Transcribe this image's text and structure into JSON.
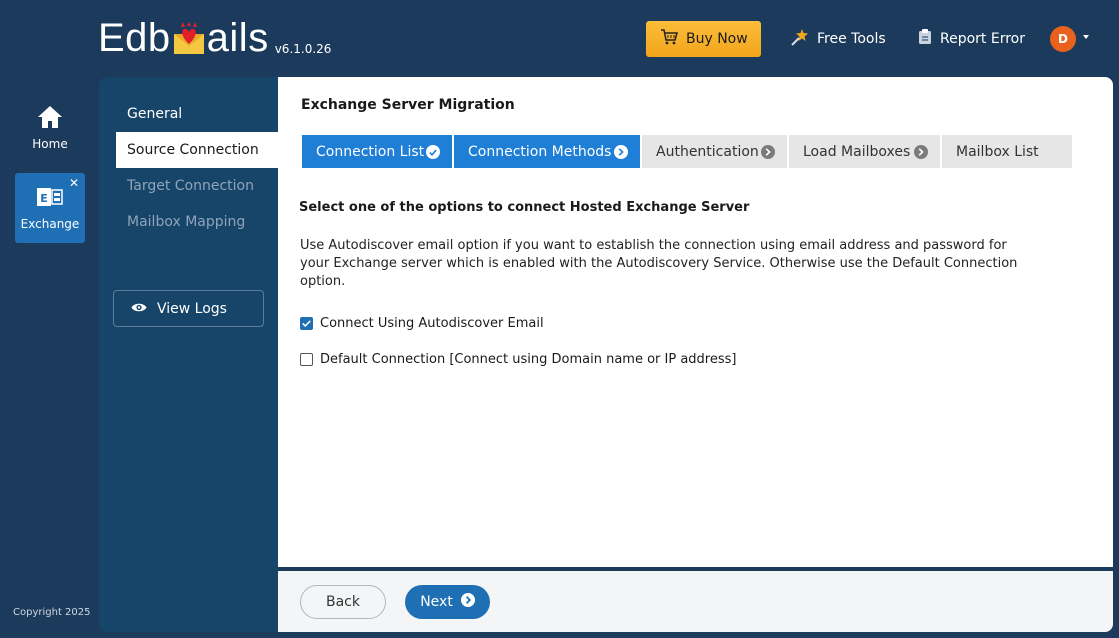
{
  "app": {
    "logo_prefix": "Edb",
    "logo_suffix": "ails",
    "version": "v6.1.0.26"
  },
  "header": {
    "buy_now": "Buy Now",
    "free_tools": "Free Tools",
    "report_error": "Report Error",
    "avatar_initial": "D"
  },
  "rail": {
    "home": "Home",
    "exchange": "Exchange",
    "close": "✕",
    "copyright": "Copyright 2025"
  },
  "sidebar": {
    "items": [
      {
        "label": "General",
        "state": "normal"
      },
      {
        "label": "Source Connection",
        "state": "active"
      },
      {
        "label": "Target Connection",
        "state": "disabled"
      },
      {
        "label": "Mailbox Mapping",
        "state": "disabled"
      }
    ],
    "view_logs": "View Logs"
  },
  "main": {
    "title": "Exchange Server Migration",
    "steps": [
      {
        "label": "Connection List",
        "status": "done"
      },
      {
        "label": "Connection Methods",
        "status": "current"
      },
      {
        "label": "Authentication",
        "status": "pending"
      },
      {
        "label": "Load Mailboxes",
        "status": "pending"
      },
      {
        "label": "Mailbox List",
        "status": "pending"
      }
    ],
    "heading": "Select one of the options to connect Hosted Exchange Server",
    "description": "Use Autodiscover email option if you want to establish the connection using email address and password for your Exchange server which is enabled with the Autodiscovery Service. Otherwise use the Default Connection option.",
    "options": [
      {
        "label": "Connect Using Autodiscover Email",
        "checked": true
      },
      {
        "label": "Default Connection [Connect using Domain name or IP address]",
        "checked": false
      }
    ]
  },
  "footer": {
    "back": "Back",
    "next": "Next"
  },
  "colors": {
    "background": "#1b3a5c",
    "sidebar": "#174469",
    "accent": "#1f7ed6",
    "buy_button": "#f3a51b",
    "avatar": "#e8611d"
  }
}
